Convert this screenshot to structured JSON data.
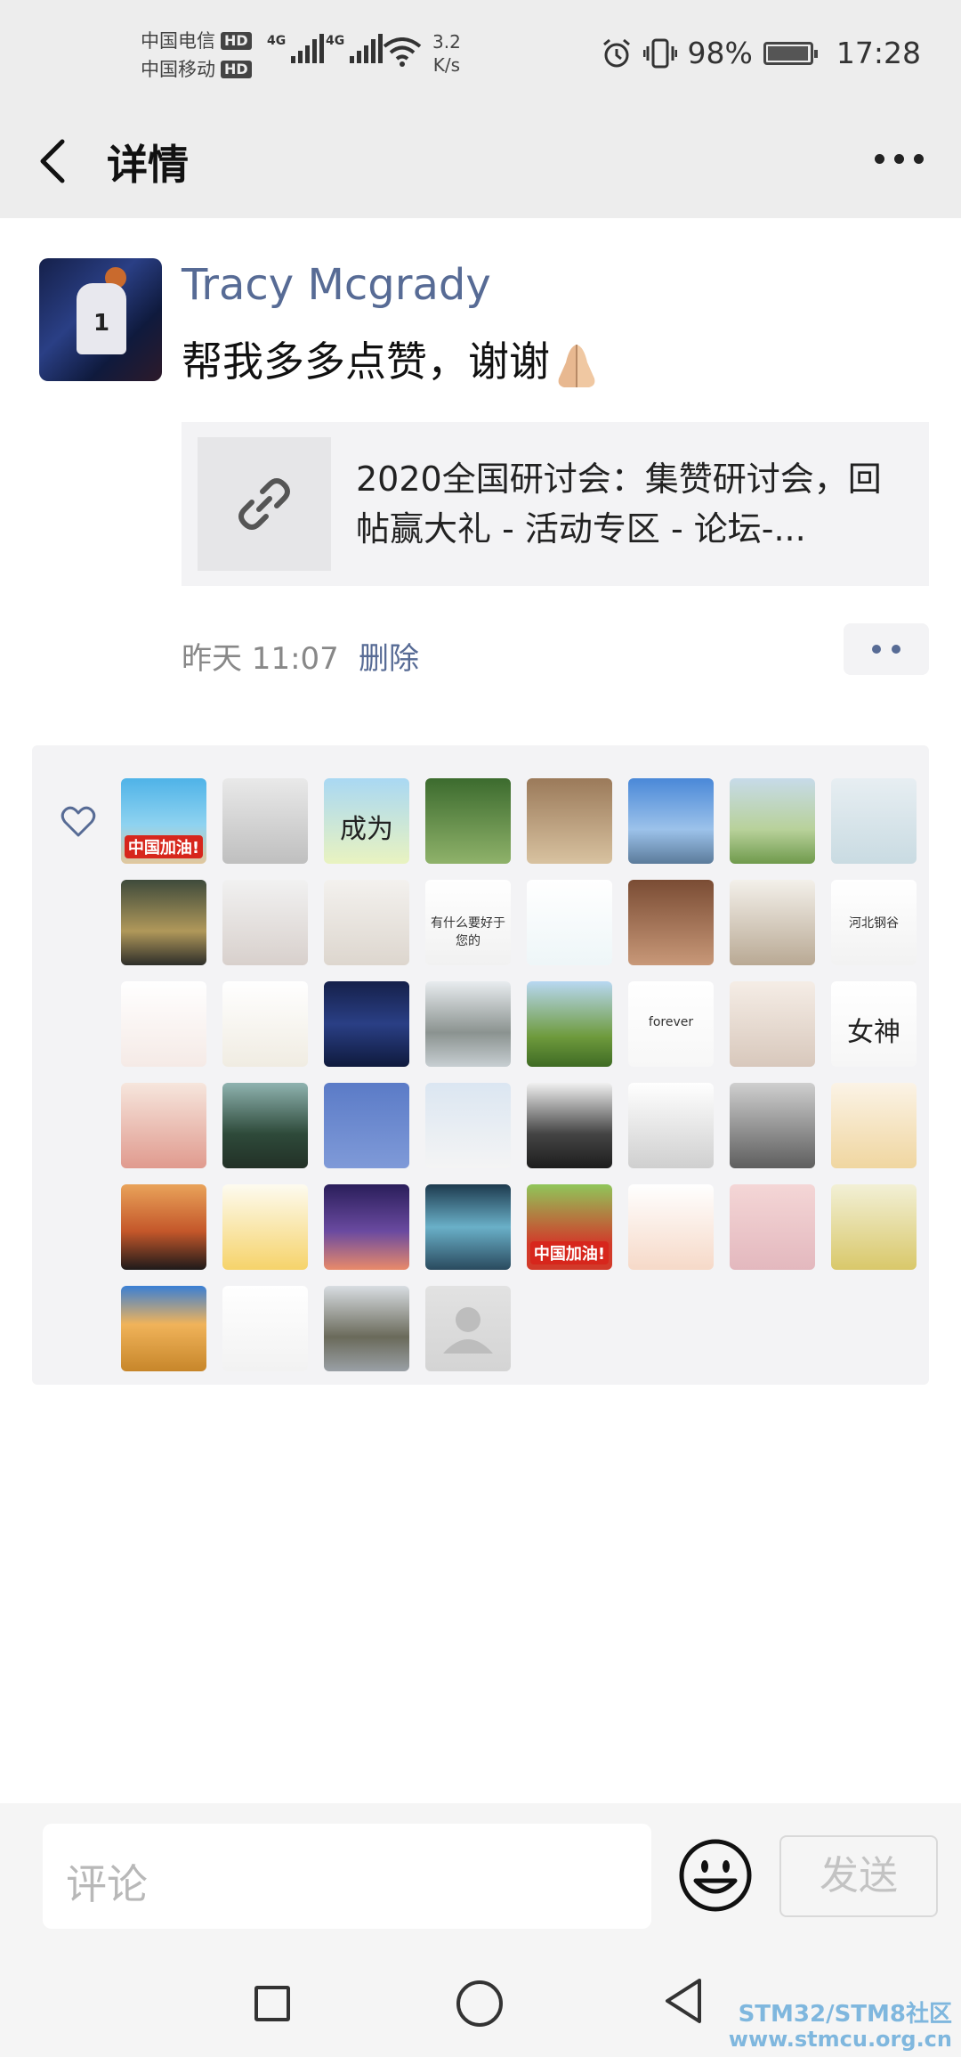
{
  "status_bar": {
    "carrier1": "中国电信",
    "carrier2": "中国移动",
    "hd": "HD",
    "network1": "4G",
    "network2": "4G",
    "speed_value": "3.2",
    "speed_unit": "K/s",
    "battery": "98%",
    "battery_level": 0.98,
    "time": "17:28"
  },
  "nav": {
    "title": "详情"
  },
  "post": {
    "username": "Tracy Mcgrady",
    "content": "帮我多多点赞，谢谢",
    "link_title": "2020全国研讨会：集赞研讨会，回帖赢大礼 - 活动专区 - 论坛-...",
    "time": "昨天 11:07",
    "delete_label": "删除"
  },
  "likes": {
    "avatars": [
      {
        "caption": "中国加油!"
      },
      {
        "caption": ""
      },
      {
        "caption": "成为"
      },
      {
        "caption": ""
      },
      {
        "caption": ""
      },
      {
        "caption": ""
      },
      {
        "caption": ""
      },
      {
        "caption": ""
      },
      {
        "caption": ""
      },
      {
        "caption": ""
      },
      {
        "caption": ""
      },
      {
        "caption": "有什么要好于您的"
      },
      {
        "caption": ""
      },
      {
        "caption": ""
      },
      {
        "caption": ""
      },
      {
        "caption": "河北钢谷"
      },
      {
        "caption": ""
      },
      {
        "caption": ""
      },
      {
        "caption": ""
      },
      {
        "caption": ""
      },
      {
        "caption": ""
      },
      {
        "caption": "forever"
      },
      {
        "caption": ""
      },
      {
        "caption": "女神"
      },
      {
        "caption": ""
      },
      {
        "caption": ""
      },
      {
        "caption": ""
      },
      {
        "caption": ""
      },
      {
        "caption": ""
      },
      {
        "caption": ""
      },
      {
        "caption": ""
      },
      {
        "caption": ""
      },
      {
        "caption": ""
      },
      {
        "caption": ""
      },
      {
        "caption": ""
      },
      {
        "caption": ""
      },
      {
        "caption": "中国加油!"
      },
      {
        "caption": ""
      },
      {
        "caption": ""
      },
      {
        "caption": ""
      },
      {
        "caption": ""
      },
      {
        "caption": ""
      },
      {
        "caption": ""
      },
      {
        "caption": ""
      }
    ]
  },
  "comment": {
    "placeholder": "评论",
    "send_label": "发送"
  },
  "watermark": {
    "line1": "STM32/STM8社区",
    "line2": "www.stmcu.org.cn"
  }
}
